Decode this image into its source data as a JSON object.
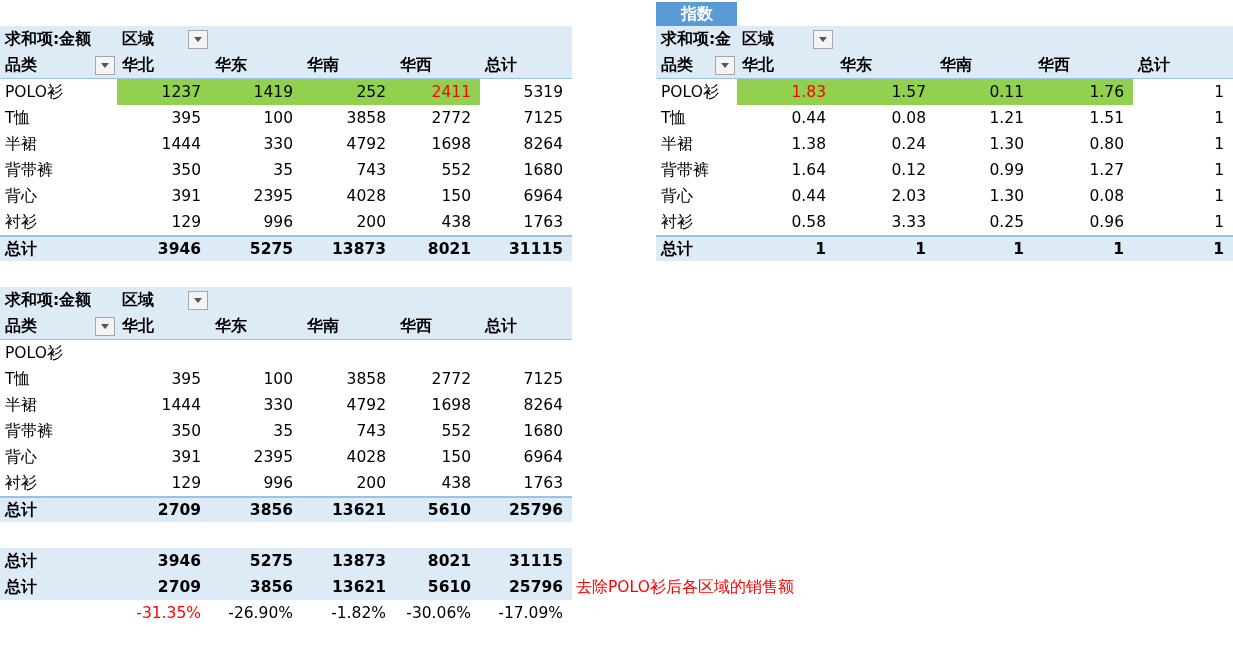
{
  "tables": [
    {
      "value_label": "求和项:金额",
      "column_field": "区域",
      "row_field": "品类",
      "columns": [
        "华北",
        "华东",
        "华南",
        "华西",
        "总计"
      ],
      "rows": [
        {
          "category": "POLO衫",
          "values": [
            "1237",
            "1419",
            "252",
            "2411"
          ],
          "total": "5319",
          "highlighted": true,
          "emphasized": [
            false,
            false,
            false,
            true
          ]
        },
        {
          "category": "T恤",
          "values": [
            "395",
            "100",
            "3858",
            "2772"
          ],
          "total": "7125",
          "highlighted": false,
          "emphasized": [
            false,
            false,
            false,
            false
          ]
        },
        {
          "category": "半裙",
          "values": [
            "1444",
            "330",
            "4792",
            "1698"
          ],
          "total": "8264",
          "highlighted": false,
          "emphasized": [
            false,
            false,
            false,
            false
          ]
        },
        {
          "category": "背带裤",
          "values": [
            "350",
            "35",
            "743",
            "552"
          ],
          "total": "1680",
          "highlighted": false,
          "emphasized": [
            false,
            false,
            false,
            false
          ]
        },
        {
          "category": "背心",
          "values": [
            "391",
            "2395",
            "4028",
            "150"
          ],
          "total": "6964",
          "highlighted": false,
          "emphasized": [
            false,
            false,
            false,
            false
          ]
        },
        {
          "category": "衬衫",
          "values": [
            "129",
            "996",
            "200",
            "438"
          ],
          "total": "1763",
          "highlighted": false,
          "emphasized": [
            false,
            false,
            false,
            false
          ]
        }
      ],
      "total_row": {
        "label": "总计",
        "values": [
          "3946",
          "5275",
          "13873",
          "8021"
        ],
        "total": "31115"
      }
    },
    {
      "tab": "指数",
      "value_label": "求和项:金",
      "column_field": "区域",
      "row_field": "品类",
      "columns": [
        "华北",
        "华东",
        "华南",
        "华西",
        "总计"
      ],
      "rows": [
        {
          "category": "POLO衫",
          "values": [
            "1.83",
            "1.57",
            "0.11",
            "1.76"
          ],
          "total": "1",
          "highlighted": true,
          "emphasized": [
            true,
            false,
            false,
            false
          ]
        },
        {
          "category": "T恤",
          "values": [
            "0.44",
            "0.08",
            "1.21",
            "1.51"
          ],
          "total": "1",
          "highlighted": false,
          "emphasized": [
            false,
            false,
            false,
            false
          ]
        },
        {
          "category": "半裙",
          "values": [
            "1.38",
            "0.24",
            "1.30",
            "0.80"
          ],
          "total": "1",
          "highlighted": false,
          "emphasized": [
            false,
            false,
            false,
            false
          ]
        },
        {
          "category": "背带裤",
          "values": [
            "1.64",
            "0.12",
            "0.99",
            "1.27"
          ],
          "total": "1",
          "highlighted": false,
          "emphasized": [
            false,
            false,
            false,
            false
          ]
        },
        {
          "category": "背心",
          "values": [
            "0.44",
            "2.03",
            "1.30",
            "0.08"
          ],
          "total": "1",
          "highlighted": false,
          "emphasized": [
            false,
            false,
            false,
            false
          ]
        },
        {
          "category": "衬衫",
          "values": [
            "0.58",
            "3.33",
            "0.25",
            "0.96"
          ],
          "total": "1",
          "highlighted": false,
          "emphasized": [
            false,
            false,
            false,
            false
          ]
        }
      ],
      "total_row": {
        "label": "总计",
        "values": [
          "1",
          "1",
          "1",
          "1"
        ],
        "total": "1"
      }
    },
    {
      "value_label": "求和项:金额",
      "column_field": "区域",
      "row_field": "品类",
      "columns": [
        "华北",
        "华东",
        "华南",
        "华西",
        "总计"
      ],
      "rows": [
        {
          "category": "POLO衫",
          "highlighted": false
        },
        {
          "category": "T恤",
          "values": [
            "395",
            "100",
            "3858",
            "2772"
          ],
          "total": "7125",
          "highlighted": false,
          "emphasized": [
            false,
            false,
            false,
            false
          ]
        },
        {
          "category": "半裙",
          "values": [
            "1444",
            "330",
            "4792",
            "1698"
          ],
          "total": "8264",
          "highlighted": false,
          "emphasized": [
            false,
            false,
            false,
            false
          ]
        },
        {
          "category": "背带裤",
          "values": [
            "350",
            "35",
            "743",
            "552"
          ],
          "total": "1680",
          "highlighted": false,
          "emphasized": [
            false,
            false,
            false,
            false
          ]
        },
        {
          "category": "背心",
          "values": [
            "391",
            "2395",
            "4028",
            "150"
          ],
          "total": "6964",
          "highlighted": false,
          "emphasized": [
            false,
            false,
            false,
            false
          ]
        },
        {
          "category": "衬衫",
          "values": [
            "129",
            "996",
            "200",
            "438"
          ],
          "total": "1763",
          "highlighted": false,
          "emphasized": [
            false,
            false,
            false,
            false
          ]
        }
      ],
      "total_row": {
        "label": "总计",
        "values": [
          "2709",
          "3856",
          "13621",
          "5610"
        ],
        "total": "25796"
      }
    }
  ],
  "comparison": {
    "rows": [
      {
        "label": "总计",
        "values": [
          "3946",
          "5275",
          "13873",
          "8021",
          "31115"
        ]
      },
      {
        "label": "总计",
        "values": [
          "2709",
          "3856",
          "13621",
          "5610",
          "25796"
        ],
        "note": "去除POLO衫后各区域的销售额"
      }
    ],
    "changes": [
      "-31.35%",
      "-26.90%",
      "-1.82%",
      "-30.06%",
      "-17.09%"
    ],
    "emphasized": [
      true,
      false,
      false,
      false,
      false
    ]
  }
}
